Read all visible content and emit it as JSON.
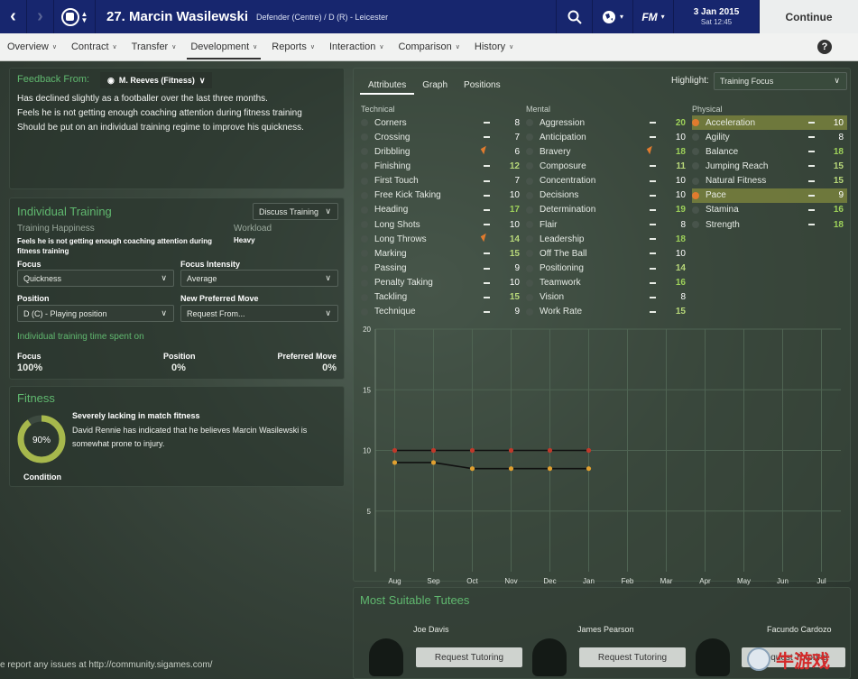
{
  "header": {
    "title": "27. Marcin Wasilewski",
    "subtitle": "Defender (Centre) / D (R) - Leicester",
    "date": "3 Jan 2015",
    "time": "Sat 12:45",
    "continue_label": "Continue",
    "fm_label": "FM"
  },
  "menu": [
    {
      "label": "Overview"
    },
    {
      "label": "Contract"
    },
    {
      "label": "Transfer"
    },
    {
      "label": "Development"
    },
    {
      "label": "Reports"
    },
    {
      "label": "Interaction"
    },
    {
      "label": "Comparison"
    },
    {
      "label": "History"
    }
  ],
  "help_label": "?",
  "feedback": {
    "label": "Feedback From:",
    "coach": "M. Reeves (Fitness)",
    "lines": [
      "Has declined slightly as a footballer over the last three months.",
      "Feels he is not getting enough coaching attention during fitness training",
      "Should be put on an individual training regime to improve his quickness."
    ]
  },
  "training": {
    "title": "Individual Training",
    "discuss": "Discuss Training",
    "happiness_label": "Training Happiness",
    "happiness_text": "Feels he is not getting enough coaching attention during fitness training",
    "workload_label": "Workload",
    "workload": "Heavy",
    "focus_label": "Focus",
    "focus": "Quickness",
    "intensity_label": "Focus Intensity",
    "intensity": "Average",
    "position_label": "Position",
    "position": "D (C) - Playing position",
    "preferred_label": "New Preferred Move",
    "preferred": "Request From...",
    "time_title": "Individual training time spent on",
    "focus_t_label": "Focus",
    "focus_t": "100%",
    "position_t_label": "Position",
    "position_t": "0%",
    "move_t_label": "Preferred Move",
    "move_t": "0%"
  },
  "fitness": {
    "title": "Fitness",
    "percent": "90%",
    "percent_value": 0.9,
    "condition_label": "Condition",
    "headline": "Severely lacking in match fitness",
    "text": "David Rennie has indicated that he believes Marcin Wasilewski is somewhat prone to injury."
  },
  "tabs": [
    {
      "label": "Attributes"
    },
    {
      "label": "Graph"
    },
    {
      "label": "Positions"
    }
  ],
  "highlight": {
    "label": "Highlight:",
    "value": "Training Focus"
  },
  "groups": {
    "technical": "Technical",
    "mental": "Mental",
    "physical": "Physical"
  },
  "technical": [
    {
      "name": "Corners",
      "value": "8"
    },
    {
      "name": "Crossing",
      "value": "7"
    },
    {
      "name": "Dribbling",
      "value": "6"
    },
    {
      "name": "Finishing",
      "value": "12"
    },
    {
      "name": "First Touch",
      "value": "7"
    },
    {
      "name": "Free Kick Taking",
      "value": "10"
    },
    {
      "name": "Heading",
      "value": "17"
    },
    {
      "name": "Long Shots",
      "value": "10"
    },
    {
      "name": "Long Throws",
      "value": "14"
    },
    {
      "name": "Marking",
      "value": "15"
    },
    {
      "name": "Passing",
      "value": "9"
    },
    {
      "name": "Penalty Taking",
      "value": "10"
    },
    {
      "name": "Tackling",
      "value": "15"
    },
    {
      "name": "Technique",
      "value": "9"
    }
  ],
  "mental": [
    {
      "name": "Aggression",
      "value": "20"
    },
    {
      "name": "Anticipation",
      "value": "10"
    },
    {
      "name": "Bravery",
      "value": "18"
    },
    {
      "name": "Composure",
      "value": "11"
    },
    {
      "name": "Concentration",
      "value": "10"
    },
    {
      "name": "Decisions",
      "value": "10"
    },
    {
      "name": "Determination",
      "value": "19"
    },
    {
      "name": "Flair",
      "value": "8"
    },
    {
      "name": "Leadership",
      "value": "18"
    },
    {
      "name": "Off The Ball",
      "value": "10"
    },
    {
      "name": "Positioning",
      "value": "14"
    },
    {
      "name": "Teamwork",
      "value": "16"
    },
    {
      "name": "Vision",
      "value": "8"
    },
    {
      "name": "Work Rate",
      "value": "15"
    }
  ],
  "physical": [
    {
      "name": "Acceleration",
      "value": "10"
    },
    {
      "name": "Agility",
      "value": "8"
    },
    {
      "name": "Balance",
      "value": "18"
    },
    {
      "name": "Jumping Reach",
      "value": "15"
    },
    {
      "name": "Natural Fitness",
      "value": "15"
    },
    {
      "name": "Pace",
      "value": "9"
    },
    {
      "name": "Stamina",
      "value": "16"
    },
    {
      "name": "Strength",
      "value": "18"
    }
  ],
  "chart_data": {
    "type": "line",
    "x": [
      "Aug",
      "Sep",
      "Oct",
      "Nov",
      "Dec",
      "Jan",
      "Feb",
      "Mar",
      "Apr",
      "May",
      "Jun",
      "Jul"
    ],
    "yticks": [
      "20",
      "15",
      "10",
      "5"
    ],
    "ylim": [
      0,
      20
    ],
    "series": [
      {
        "values": [
          10,
          10,
          10,
          10,
          10,
          10
        ],
        "color": "#c0392b"
      },
      {
        "values": [
          9,
          9,
          8.5,
          8.5,
          8.5,
          8.5
        ],
        "color": "#e0a030"
      }
    ]
  },
  "tutees": {
    "title": "Most Suitable Tutees",
    "players": [
      {
        "name": "Joe Davis",
        "button": "Request Tutoring"
      },
      {
        "name": "James Pearson",
        "button": "Request Tutoring"
      },
      {
        "name": "Facundo Cardozo",
        "button": "Request Tutoring"
      }
    ]
  },
  "footer": "e report any issues at http://community.sigames.com/",
  "watermark": "牛游戏"
}
